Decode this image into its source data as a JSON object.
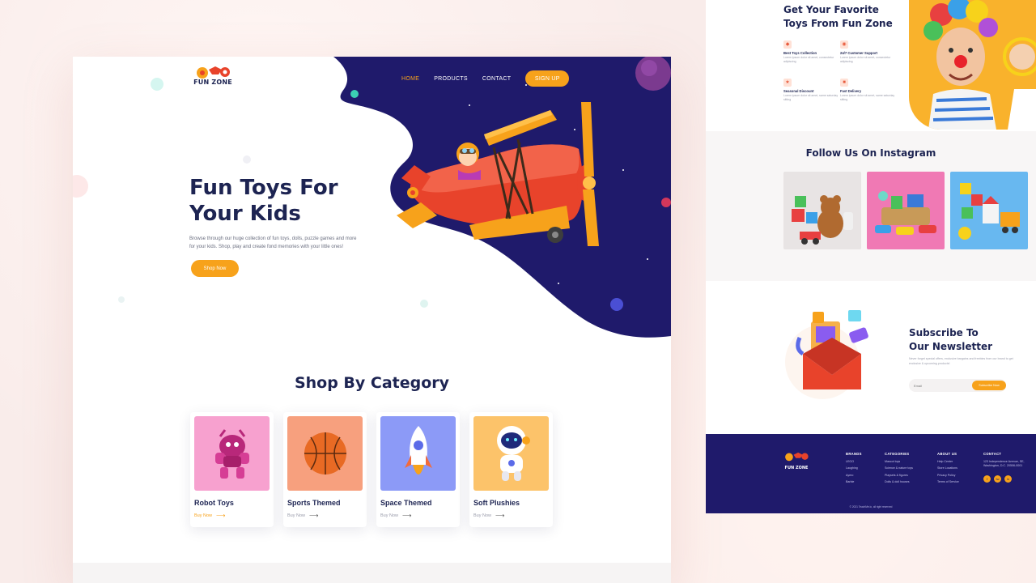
{
  "main": {
    "logo_text": "FUN ZONE",
    "nav": [
      {
        "label": "HOME",
        "active": true
      },
      {
        "label": "PRODUCTS",
        "active": false
      },
      {
        "label": "CONTACT",
        "active": false
      }
    ],
    "signup_label": "SIGN UP",
    "hero_title_line1": "Fun Toys For",
    "hero_title_line2": "Your Kids",
    "hero_desc_line1": "Browse through our huge collection of fun toys, dolls, puzzle games and more",
    "hero_desc_line2": "for your kids. Shop, play and create fond memories with your little ones!",
    "shop_now_label": "Shop Now",
    "section_title": "Shop By Category",
    "categories": [
      {
        "title": "Robot Toys",
        "link": "Buy Now",
        "color": "#f7a1cf",
        "icon": "robot-icon"
      },
      {
        "title": "Sports Themed",
        "link": "Buy Now",
        "color": "#f7a07e",
        "icon": "basketball-icon"
      },
      {
        "title": "Space Themed",
        "link": "Buy Now",
        "color": "#8c9af7",
        "icon": "rocket-icon"
      },
      {
        "title": "Soft Plushies",
        "link": "Buy Now",
        "color": "#fcc36a",
        "icon": "astronaut-icon"
      }
    ]
  },
  "right": {
    "fav_title_line1": "Get Your Favorite",
    "fav_title_line2": "Toys From Fun Zone",
    "features": [
      {
        "title": "Best Toys Collection",
        "desc": "Lorem ipsum dolor sit amet, consectetur adipiscing"
      },
      {
        "title": "24/7 Customer Support",
        "desc": "Lorem ipsum dolor sit amet, consectetur adipiscing"
      },
      {
        "title": "Seasonal Discount",
        "desc": "Lorem ipsum dolor sit amet, same saturday sitting"
      },
      {
        "title": "Fast Delivery",
        "desc": "Lorem ipsum dolor sit amet, same saturday sitting"
      }
    ],
    "instagram_title": "Follow Us On Instagram",
    "newsletter_title_line1": "Subscribe To",
    "newsletter_title_line2": "Our Newsletter",
    "newsletter_desc": "Never forget special offers, exclusive bargains and freebies from our brand to get exclusive & upcoming products!",
    "newsletter_placeholder": "Email",
    "newsletter_button": "Subscribe Now",
    "footer": {
      "logo_text": "FUN ZONE",
      "columns": [
        {
          "title": "BRANDS",
          "items": [
            "LEGO",
            "Laughing",
            "Ayero",
            "Barbie"
          ]
        },
        {
          "title": "CATEGORIES",
          "items": [
            "Mascot toys",
            "Science & nature toys",
            "Playsets & figures",
            "Dolls & doll houses"
          ]
        },
        {
          "title": "ABOUT US",
          "items": [
            "Help Center",
            "Store Locations",
            "Privacy Policy",
            "Terms of Service"
          ]
        },
        {
          "title": "CONTACT",
          "items": [
            "123 Independence Avenue, SE,",
            "Washington, D.C. 20506-0001"
          ]
        }
      ],
      "socials": [
        "f",
        "tw",
        "in"
      ],
      "copyright": "© 2021 TeachMe.io, all right reserved"
    }
  },
  "colors": {
    "navy": "#1d2452",
    "accent": "#f7a21b",
    "hero_bg": "#1f1a6b",
    "footer_bg": "#1f1a6b"
  }
}
